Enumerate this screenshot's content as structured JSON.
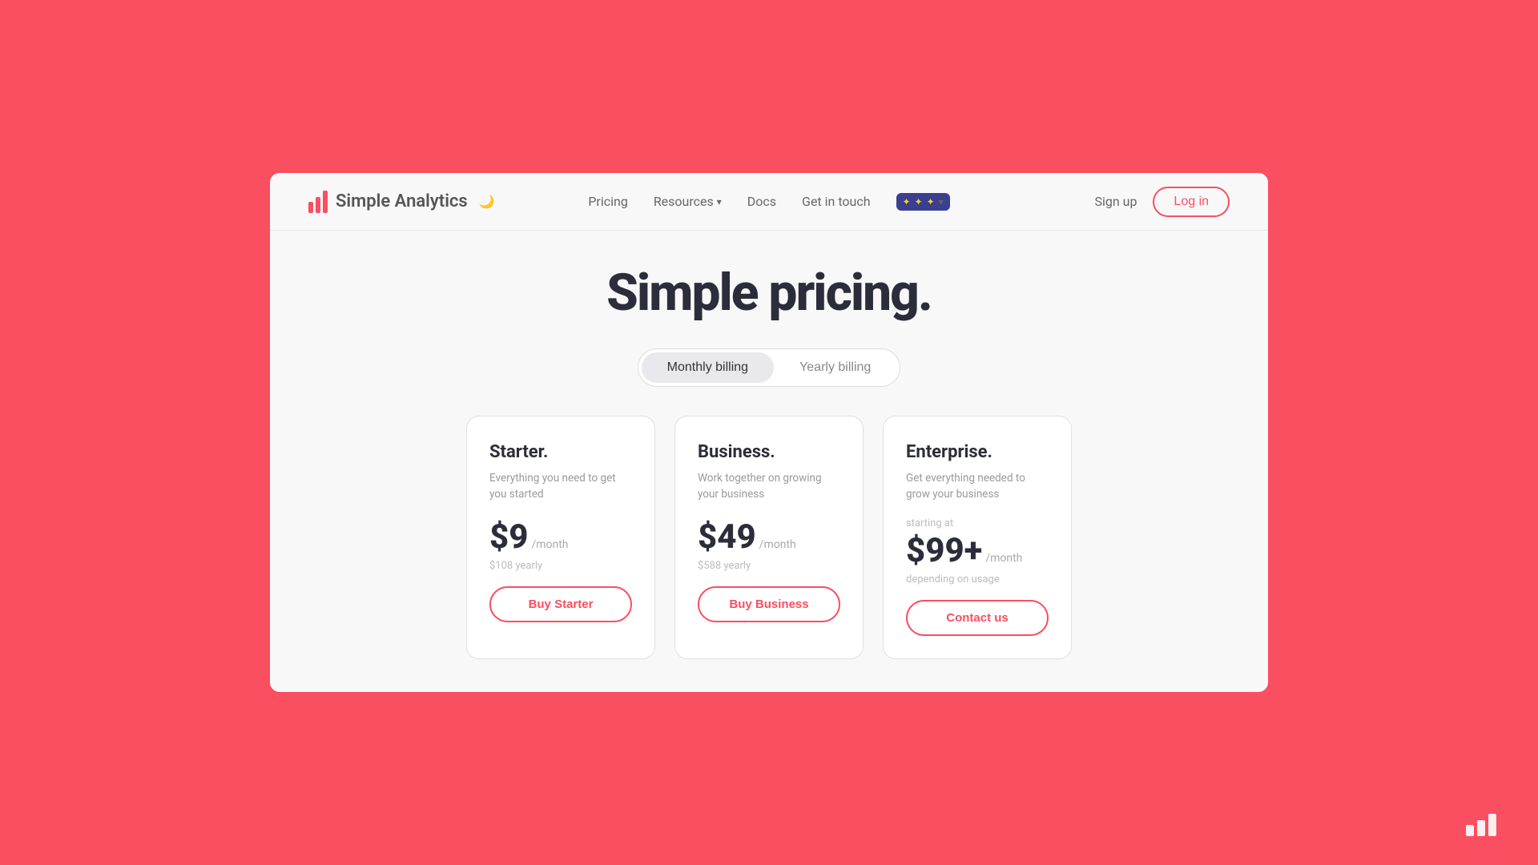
{
  "logo": {
    "text": "Simple Analytics",
    "moon": "🌙"
  },
  "nav": {
    "links": [
      {
        "label": "Pricing",
        "hasDropdown": false
      },
      {
        "label": "Resources",
        "hasDropdown": true
      },
      {
        "label": "Docs",
        "hasDropdown": false
      },
      {
        "label": "Get in touch",
        "hasDropdown": false
      }
    ],
    "eu_badge": "🇪🇺",
    "sign_up": "Sign up",
    "login": "Log in"
  },
  "hero": {
    "title": "Simple pricing."
  },
  "billing": {
    "monthly_label": "Monthly billing",
    "yearly_label": "Yearly billing"
  },
  "plans": [
    {
      "name": "Starter.",
      "desc": "Everything you need to get you started",
      "starting_at": "",
      "price": "$9",
      "period": "/month",
      "yearly": "$108 yearly",
      "depending": "",
      "btn_label": "Buy Starter"
    },
    {
      "name": "Business.",
      "desc": "Work together on growing your business",
      "starting_at": "",
      "price": "$49",
      "period": "/month",
      "yearly": "$588 yearly",
      "depending": "",
      "btn_label": "Buy Business"
    },
    {
      "name": "Enterprise.",
      "desc": "Get everything needed to grow your business",
      "starting_at": "starting at",
      "price": "$99+",
      "period": "/month",
      "yearly": "",
      "depending": "depending on usage",
      "btn_label": "Contact us"
    }
  ],
  "bottom_icon": {
    "bars": [
      14,
      20,
      28
    ]
  }
}
